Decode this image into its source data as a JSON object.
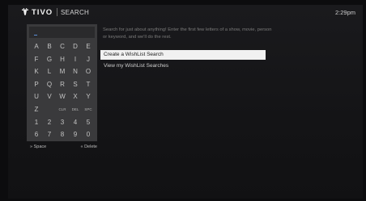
{
  "header": {
    "logo_text": "TIVO",
    "title": "SEARCH",
    "time": "2:29pm"
  },
  "keyboard": {
    "rows": [
      [
        "A",
        "B",
        "C",
        "D",
        "E"
      ],
      [
        "F",
        "G",
        "H",
        "I",
        "J"
      ],
      [
        "K",
        "L",
        "M",
        "N",
        "O"
      ],
      [
        "P",
        "Q",
        "R",
        "S",
        "T"
      ],
      [
        "U",
        "V",
        "W",
        "X",
        "Y"
      ],
      [
        "Z",
        "",
        "CLR",
        "DEL",
        "SPC"
      ],
      [
        "1",
        "2",
        "3",
        "4",
        "5"
      ],
      [
        "6",
        "7",
        "8",
        "9",
        "0"
      ]
    ],
    "space_hint": "» Space",
    "delete_hint": "« Delete"
  },
  "instructions": "Search for just about anything! Enter the first few letters of a show, movie, person or keyword, and we'll do the rest.",
  "menu": {
    "items": [
      {
        "label": "Create a WishList Search"
      },
      {
        "label": "View my WishList Searches"
      }
    ]
  },
  "colors": {
    "background": "#111114",
    "panel": "#3a3a3c",
    "highlight": "#f1f1f1",
    "cursor": "#5b8ed8"
  }
}
